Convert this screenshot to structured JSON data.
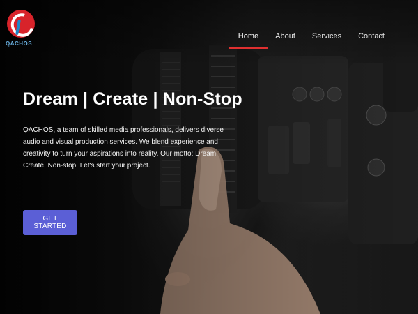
{
  "brand": {
    "logo_text": "QACHOS",
    "colors": {
      "red": "#d8232a",
      "blue": "#1e88c8"
    }
  },
  "nav": {
    "items": [
      {
        "label": "Home",
        "active": true
      },
      {
        "label": "About",
        "active": false
      },
      {
        "label": "Services",
        "active": false
      },
      {
        "label": "Contact",
        "active": false
      }
    ],
    "active_indicator_color": "#e03030"
  },
  "hero": {
    "headline": "Dream | Create | Non-Stop",
    "description": "QACHOS, a team of skilled media professionals, delivers diverse audio and visual production services. We blend experience and creativity to turn your aspirations into reality. Our motto: Dream. Create. Non-stop. Let's start your project.",
    "cta_label": "GET STARTED",
    "cta_color": "#5b5fd6",
    "background_image": "video camera with hand"
  }
}
